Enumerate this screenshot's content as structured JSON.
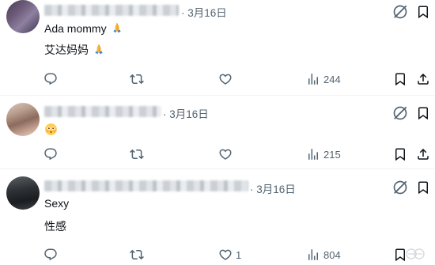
{
  "posts": [
    {
      "timestamp": "· 3月16日",
      "lines": [
        "Ada mommy",
        "艾达妈妈"
      ],
      "views": "244",
      "likes": ""
    },
    {
      "timestamp": "· 3月16日",
      "lines": [],
      "views": "215",
      "likes": ""
    },
    {
      "timestamp": "· 3月16日",
      "lines": [
        "Sexy",
        "性感"
      ],
      "views": "804",
      "likes": "1"
    }
  ],
  "icons": {
    "reply": "reply-icon",
    "repost": "repost-icon",
    "like": "heart-icon",
    "views": "views-chart-icon",
    "bookmark": "bookmark-icon",
    "share": "share-icon",
    "grok": "grok-icon",
    "more": "more-icon"
  },
  "colors": {
    "text": "#0f1419",
    "muted": "#536471",
    "divider": "#eff3f4"
  }
}
